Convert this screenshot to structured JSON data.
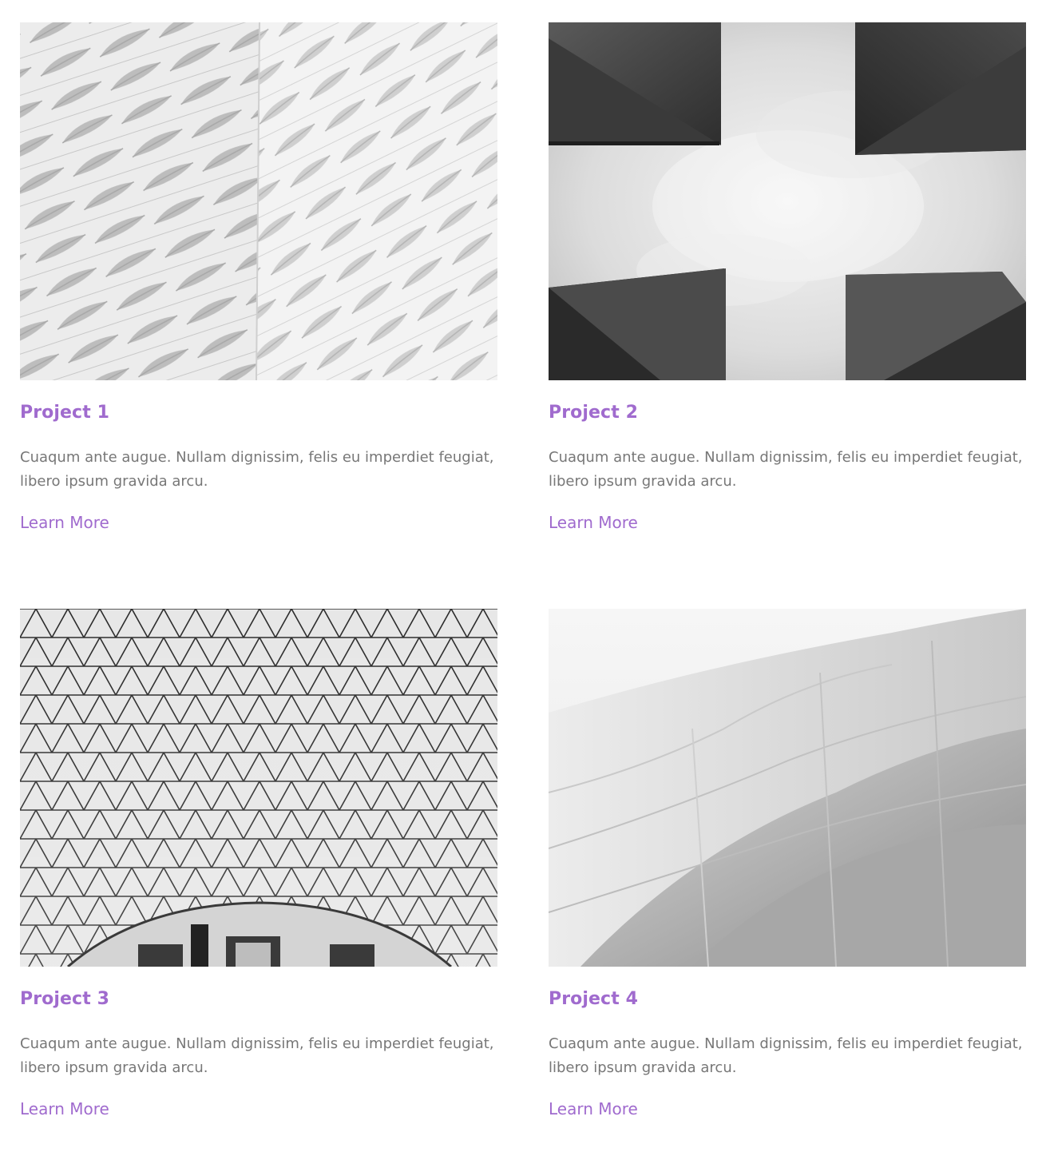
{
  "projects": [
    {
      "title": "Project 1",
      "description": "Cuaqum ante augue. Nullam dignissim, felis eu imperdiet feugiat, libero ipsum gravida arcu.",
      "link_label": "Learn More",
      "image": "architecture-facade-wave-pattern"
    },
    {
      "title": "Project 2",
      "description": "Cuaqum ante augue. Nullam dignissim, felis eu imperdiet feugiat, libero ipsum gravida arcu.",
      "link_label": "Learn More",
      "image": "concrete-blocks-looking-up-sky"
    },
    {
      "title": "Project 3",
      "description": "Cuaqum ante augue. Nullam dignissim, felis eu imperdiet feugiat, libero ipsum gravida arcu.",
      "link_label": "Learn More",
      "image": "glass-lattice-dome-roof"
    },
    {
      "title": "Project 4",
      "description": "Cuaqum ante augue. Nullam dignissim, felis eu imperdiet feugiat, libero ipsum gravida arcu.",
      "link_label": "Learn More",
      "image": "curved-metal-panel-building"
    }
  ],
  "colors": {
    "accent": "#a06bce",
    "body_text": "#777777",
    "background": "#ffffff"
  }
}
